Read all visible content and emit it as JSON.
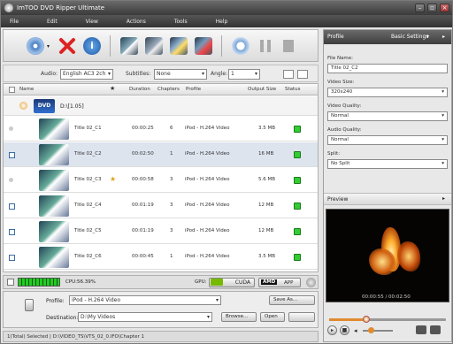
{
  "app": {
    "title": "ImTOO DVD Ripper Ultimate"
  },
  "menu": [
    "File",
    "Edit",
    "View",
    "Actions",
    "Tools",
    "Help"
  ],
  "filters": {
    "audio_label": "Audio:",
    "audio_value": "English AC3 2ch",
    "subtitles_label": "Subtitles:",
    "subtitles_value": "None",
    "angle_label": "Angle:",
    "angle_value": "1"
  },
  "columns": [
    "Name",
    "Duration",
    "Chapters",
    "Profile",
    "Output Size",
    "Status"
  ],
  "disc": {
    "name": "D:\\[1.05]"
  },
  "rows": [
    {
      "name": "Title 02_C1",
      "duration": "00:00:25",
      "chapters": "6",
      "profile": "iPod - H.264 Video",
      "size": "3.5 MB",
      "checked": false
    },
    {
      "name": "Title 02_C2",
      "duration": "00:02:50",
      "chapters": "1",
      "profile": "iPod - H.264 Video",
      "size": "16 MB",
      "checked": true
    },
    {
      "name": "Title 02_C3",
      "duration": "00:00:58",
      "chapters": "3",
      "profile": "iPod - H.264 Video",
      "size": "5.6 MB",
      "checked": false
    },
    {
      "name": "Title 02_C4",
      "duration": "00:01:19",
      "chapters": "3",
      "profile": "iPod - H.264 Video",
      "size": "12 MB",
      "checked": true
    },
    {
      "name": "Title 02_C5",
      "duration": "00:01:19",
      "chapters": "3",
      "profile": "iPod - H.264 Video",
      "size": "12 MB",
      "checked": true
    },
    {
      "name": "Title 02_C6",
      "duration": "00:00:45",
      "chapters": "1",
      "profile": "iPod - H.264 Video",
      "size": "3.5 MB",
      "checked": true
    }
  ],
  "bottombar": {
    "cpu": "CPU:56.39%",
    "gpu_label": "GPU:",
    "cuda": "CUDA",
    "amd": "AMD",
    "app": "APP"
  },
  "output": {
    "profile_label": "Profile:",
    "profile_value": "iPod - H.264 Video",
    "save_as_label": "Save As...",
    "destination_label": "Destination:",
    "destination_value": "D:\\My Videos",
    "browse_label": "Browse...",
    "open_label": "Open"
  },
  "status": "1(Total) Selected | D:\\VIDEO_TS\\VTS_02_0.IFO\\Chapter 1",
  "right_panel": {
    "profile_title": "Profile",
    "basic_settings": "Basic Settings",
    "file_name_label": "File Name:",
    "file_name_value": "Title 02_C2",
    "video_size_label": "Video Size:",
    "video_size_value": "320x240",
    "video_quality_label": "Video Quality:",
    "video_quality_value": "Normal",
    "audio_quality_label": "Audio Quality:",
    "audio_quality_value": "Normal",
    "split_label": "Split:",
    "split_value": "No Split",
    "preview_title": "Preview",
    "time": "00:00:55 / 00:02:50",
    "progress": 0.32
  },
  "colors": {
    "titlebar": "#4a4a4a",
    "status_ok": "#33cc33",
    "selected_row": "#dde4ee"
  }
}
